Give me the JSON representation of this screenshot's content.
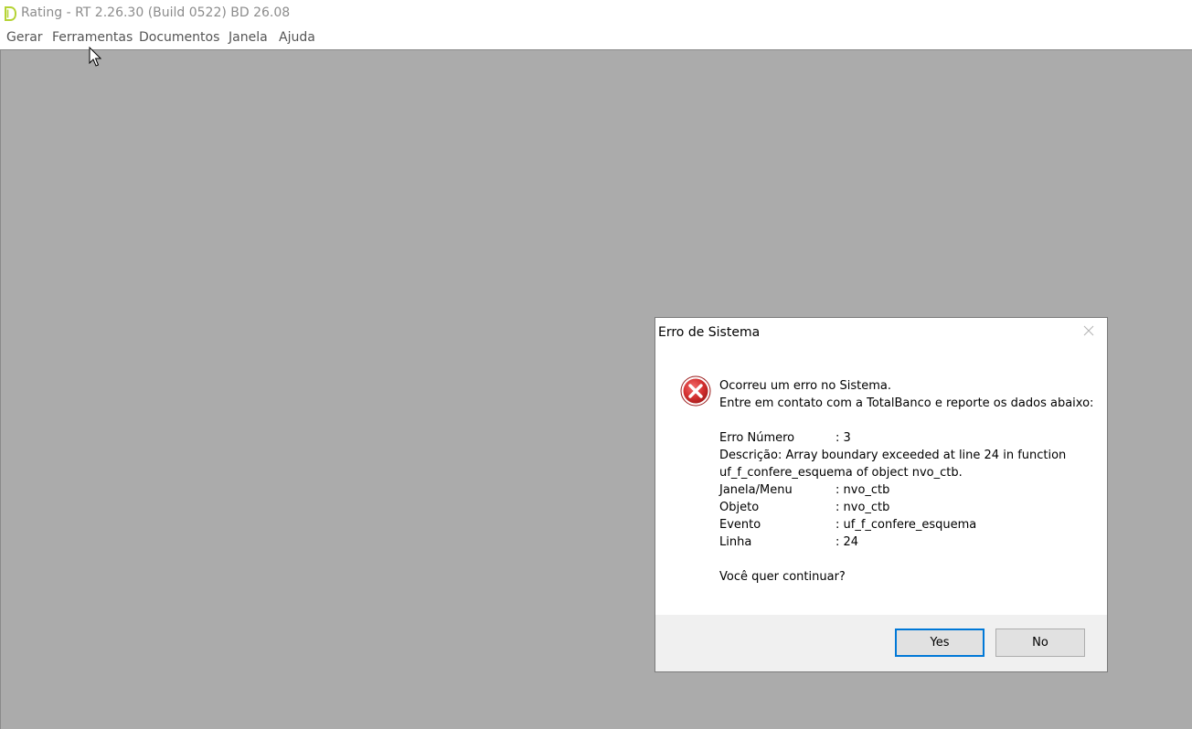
{
  "window": {
    "title": "Rating - RT 2.26.30 (Build 0522) BD 26.08",
    "icon": "app-d-logo-icon"
  },
  "menubar": {
    "items": [
      {
        "label": "Gerar"
      },
      {
        "label": "Ferramentas"
      },
      {
        "label": "Documentos"
      },
      {
        "label": "Janela"
      },
      {
        "label": "Ajuda"
      }
    ]
  },
  "dialog": {
    "title": "Erro de Sistema",
    "icon": "error-x-icon",
    "intro_line1": "Ocorreu um erro no Sistema.",
    "intro_line2": "Entre em contato com a TotalBanco e reporte os dados abaixo:",
    "fields": {
      "erro_numero": {
        "label": "Erro Número",
        "value": ": 3"
      },
      "descricao": {
        "label": "Descrição",
        "value_line1": ": Array boundary exceeded at line 24 in function",
        "value_line2": "uf_f_confere_esquema of object nvo_ctb."
      },
      "janela_menu": {
        "label": "Janela/Menu",
        "value": ": nvo_ctb"
      },
      "objeto": {
        "label": "Objeto",
        "value": ": nvo_ctb"
      },
      "evento": {
        "label": "Evento",
        "value": ": uf_f_confere_esquema"
      },
      "linha": {
        "label": "Linha",
        "value": ": 24"
      }
    },
    "question": "Você quer continuar?",
    "buttons": {
      "yes": "Yes",
      "no": "No"
    }
  },
  "colors": {
    "mdi_background": "#ababab",
    "dialog_button_strip": "#f0f0f0",
    "error_red": "#d32f2f",
    "default_button_border": "#0078d7",
    "title_text": "#8c8c8c"
  }
}
